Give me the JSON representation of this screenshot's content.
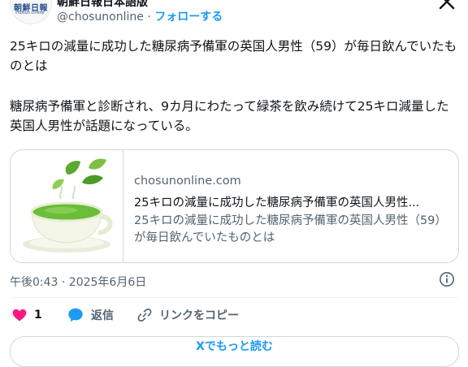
{
  "header": {
    "display_name": "朝鮮日報日本語版",
    "handle": "@chosunonline",
    "separator": " · ",
    "follow_label": "フォローする",
    "avatar_logo_jp": "朝鮮日報",
    "avatar_logo_en": "chosun Online"
  },
  "tweet": {
    "paragraph1": "25キロの減量に成功した糖尿病予備軍の英国人男性（59）が毎日飲んでいたものとは",
    "paragraph2": "糖尿病予備軍と診断され、9カ月にわたって緑茶を飲み続けて25キロ減量した英国人男性が話題になっている。"
  },
  "card": {
    "domain": "chosunonline.com",
    "title": "25キロの減量に成功した糖尿病予備軍の英国人男性...",
    "description": "25キロの減量に成功した糖尿病予備軍の英国人男性（59）が毎日飲んでいたものとは"
  },
  "meta": {
    "timestamp": "午後0:43 · 2025年6月6日"
  },
  "actions": {
    "like_count": "1",
    "reply_label": "返信",
    "copy_link_label": "リンクをコピー"
  },
  "read_more": {
    "label": "Xでもっと読む"
  },
  "colors": {
    "accent": "#1d9bf0",
    "like": "#f91880",
    "text": "#0f1419",
    "muted": "#536471",
    "border": "#cfd9de"
  },
  "icons": [
    "close-icon",
    "info-icon",
    "heart-icon",
    "reply-bubble-icon",
    "link-icon"
  ]
}
